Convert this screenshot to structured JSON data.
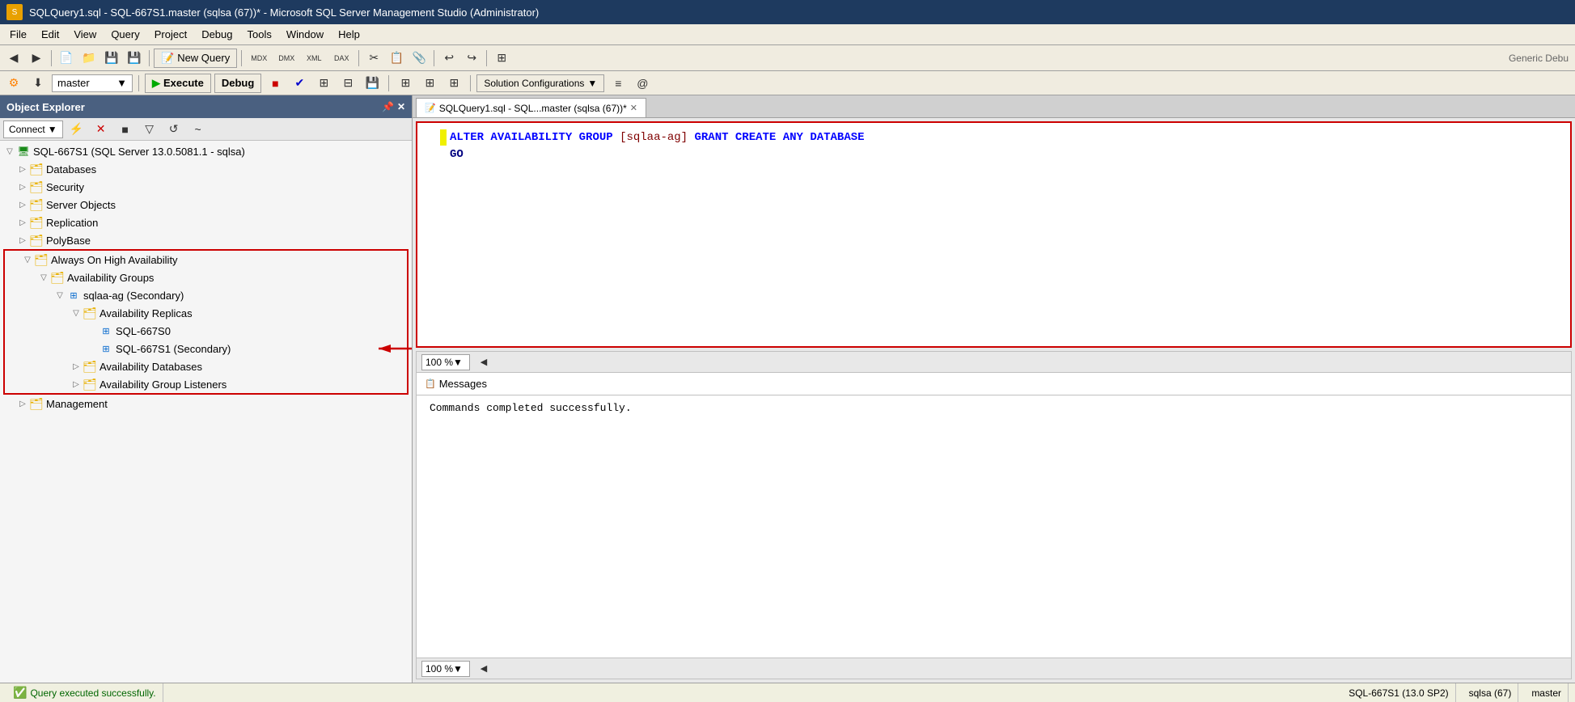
{
  "titlebar": {
    "title": "SQLQuery1.sql - SQL-667S1.master (sqlsa (67))* - Microsoft SQL Server Management Studio (Administrator)",
    "icon": "SSMS"
  },
  "menubar": {
    "items": [
      "File",
      "Edit",
      "View",
      "Query",
      "Project",
      "Debug",
      "Tools",
      "Window",
      "Help"
    ]
  },
  "toolbar1": {
    "new_query_label": "New Query",
    "generic_debug_label": "Generic Debu"
  },
  "toolbar2": {
    "database_value": "master",
    "execute_label": "Execute",
    "debug_label": "Debug",
    "solution_config_label": "Solution Configurations"
  },
  "object_explorer": {
    "title": "Object Explorer",
    "connect_label": "Connect",
    "server": "SQL-667S1 (SQL Server 13.0.5081.1 - sqlsa)",
    "nodes": [
      {
        "label": "Databases",
        "indent": 1,
        "type": "folder",
        "expanded": false
      },
      {
        "label": "Security",
        "indent": 1,
        "type": "folder",
        "expanded": false
      },
      {
        "label": "Server Objects",
        "indent": 1,
        "type": "folder",
        "expanded": false
      },
      {
        "label": "Replication",
        "indent": 1,
        "type": "folder",
        "expanded": false
      },
      {
        "label": "PolyBase",
        "indent": 1,
        "type": "folder",
        "expanded": false
      },
      {
        "label": "Always On High Availability",
        "indent": 1,
        "type": "folder",
        "expanded": true,
        "highlighted": true
      },
      {
        "label": "Availability Groups",
        "indent": 2,
        "type": "folder",
        "expanded": true,
        "highlighted": true
      },
      {
        "label": "sqlaa-ag (Secondary)",
        "indent": 3,
        "type": "ag",
        "expanded": true,
        "highlighted": true
      },
      {
        "label": "Availability Replicas",
        "indent": 4,
        "type": "folder",
        "expanded": true,
        "highlighted": true
      },
      {
        "label": "SQL-667S0",
        "indent": 5,
        "type": "replica",
        "highlighted": true
      },
      {
        "label": "SQL-667S1 (Secondary)",
        "indent": 5,
        "type": "replica",
        "highlighted": true,
        "arrow": true
      },
      {
        "label": "Availability Databases",
        "indent": 4,
        "type": "folder",
        "expanded": false,
        "highlighted": true
      },
      {
        "label": "Availability Group Listeners",
        "indent": 4,
        "type": "folder",
        "expanded": false,
        "highlighted": true
      },
      {
        "label": "Management",
        "indent": 1,
        "type": "folder",
        "expanded": false
      }
    ]
  },
  "query_tab": {
    "label": "SQLQuery1.sql - SQL...master (sqlsa (67))*"
  },
  "code": {
    "line1": "ALTER AVAILABILITY GROUP [sqlaa-ag] GRANT CREATE ANY DATABASE",
    "line1_parts": [
      {
        "text": "ALTER",
        "class": "kw-blue"
      },
      {
        "text": " AVAILABILITY GROUP ",
        "class": "kw-blue"
      },
      {
        "text": "[sqlaa-ag]",
        "class": "bracket-text"
      },
      {
        "text": " GRANT ",
        "class": "kw-blue"
      },
      {
        "text": "CREATE",
        "class": "kw-blue"
      },
      {
        "text": " ANY ",
        "class": "kw-blue"
      },
      {
        "text": "DATABASE",
        "class": "kw-blue"
      }
    ],
    "line2": "GO",
    "line2_parts": [
      {
        "text": "GO",
        "class": "kw-dark"
      }
    ]
  },
  "results": {
    "zoom_level": "100 %",
    "messages_label": "Messages",
    "messages_text": "Commands completed successfully.",
    "zoom_level2": "100 %"
  },
  "statusbar": {
    "status_text": "Query executed successfully.",
    "server": "SQL-667S1 (13.0 SP2)",
    "user": "sqlsa (67)",
    "database": "master"
  }
}
